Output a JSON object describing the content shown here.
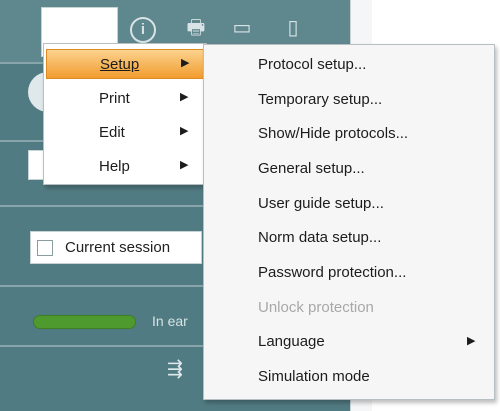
{
  "main_menu": {
    "items": [
      {
        "label": "Setup"
      },
      {
        "label": "Print"
      },
      {
        "label": "Edit"
      },
      {
        "label": "Help"
      }
    ]
  },
  "setup_submenu": {
    "items": [
      {
        "label": "Protocol setup..."
      },
      {
        "label": "Temporary setup..."
      },
      {
        "label": "Show/Hide protocols..."
      },
      {
        "label": "General setup..."
      },
      {
        "label": "User guide setup..."
      },
      {
        "label": "Norm data setup..."
      },
      {
        "label": "Password protection..."
      },
      {
        "label": "Unlock protection",
        "disabled": true
      },
      {
        "label": "Language"
      },
      {
        "label": "Simulation mode"
      }
    ]
  },
  "background": {
    "session_label": "Current session",
    "status_label": "In ear",
    "toolbar_icons": [
      "info-icon",
      "printer-icon",
      "save-icon",
      "exit-icon"
    ]
  },
  "colors": {
    "panel": "#517b82",
    "highlight": "#f29c2f",
    "status_green": "#4f9a2e"
  },
  "glyphs": {
    "submenu_arrow": "▶",
    "info": "i",
    "printer": "🖶",
    "save": "▭",
    "exit": "▯",
    "flow": "⇶"
  }
}
